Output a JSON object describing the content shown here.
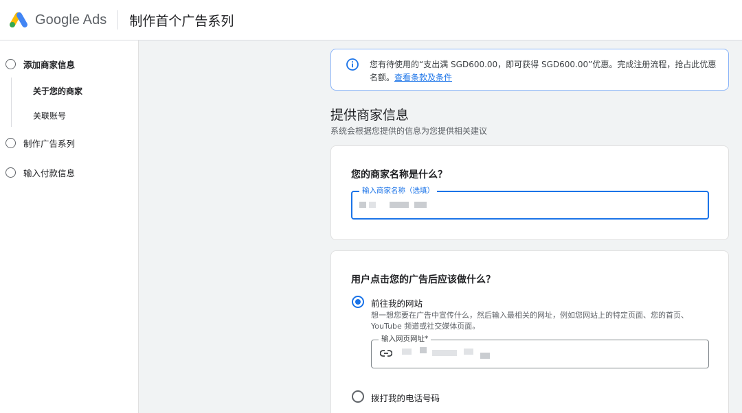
{
  "header": {
    "brand": "Google Ads",
    "title": "制作首个广告系列",
    "colors": {
      "blue": "#4285F4",
      "yellow": "#FBBC04",
      "green": "#34A853"
    }
  },
  "sidebar": {
    "steps": [
      {
        "label": "添加商家信息",
        "active": true
      },
      {
        "label": "制作广告系列",
        "active": false
      },
      {
        "label": "输入付款信息",
        "active": false
      }
    ],
    "substeps": [
      {
        "label": "关于您的商家",
        "active": true
      },
      {
        "label": "关联账号",
        "active": false
      }
    ]
  },
  "notice": {
    "icon": "info-icon",
    "text": "您有待使用的“支出满 SGD600.00，即可获得 SGD600.00”优惠。完成注册流程，抢占此优惠名额。",
    "link": "查看条款及条件"
  },
  "section": {
    "title": "提供商家信息",
    "subtitle": "系统会根据您提供的信息为您提供相关建议"
  },
  "business_card": {
    "question": "您的商家名称是什么？",
    "field_label": "输入商家名称（选填）"
  },
  "action_card": {
    "question": "用户点击您的广告后应该做什么？",
    "option_website": {
      "label": "前往我的网站",
      "description": "想一想您要在广告中宣传什么，然后输入最相关的网址，例如您网站上的特定页面、您的首页、YouTube 频道或社交媒体页面。",
      "checked": true,
      "field_label": "输入网页网址*",
      "field_icon": "link-icon"
    },
    "option_phone": {
      "label": "拨打我的电话号码",
      "checked": false
    }
  }
}
